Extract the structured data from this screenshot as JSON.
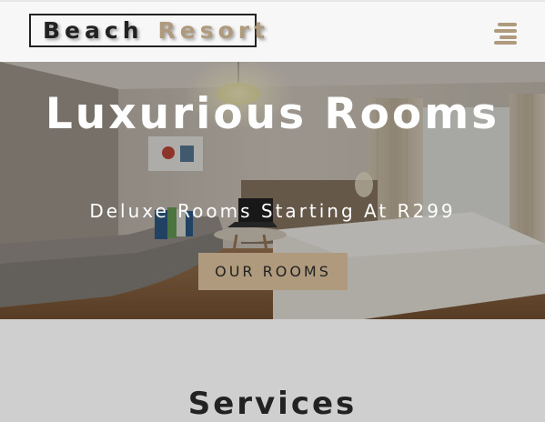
{
  "brand": {
    "part1": "Beach",
    "part2": "Resort",
    "accent_color": "#af9a7d"
  },
  "nav": {
    "menu_icon": "menu-icon"
  },
  "hero": {
    "title": "Luxurious Rooms",
    "subtitle": "Deluxe Rooms Starting At R299",
    "button_label": "OUR ROOMS"
  },
  "services": {
    "heading": "Services"
  }
}
